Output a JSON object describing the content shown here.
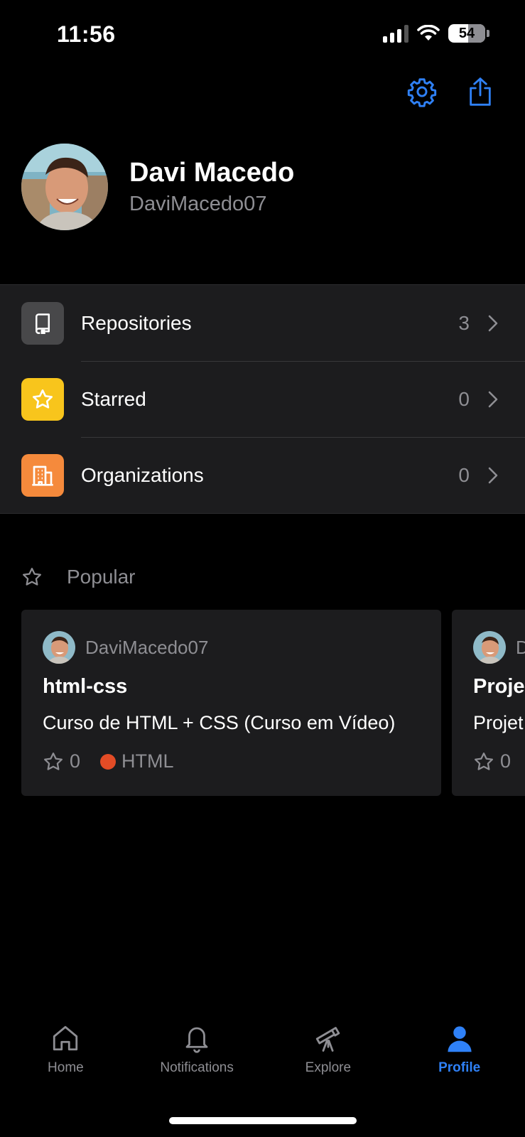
{
  "status_bar": {
    "time": "11:56",
    "battery": "54",
    "battery_level": 0.54
  },
  "profile": {
    "name": "Davi Macedo",
    "username": "DaviMacedo07"
  },
  "menu": [
    {
      "label": "Repositories",
      "count": "3",
      "color": "#48484a",
      "icon": "repo-icon"
    },
    {
      "label": "Starred",
      "count": "0",
      "color": "#f8c51c",
      "icon": "star-icon"
    },
    {
      "label": "Organizations",
      "count": "0",
      "color": "#f58a3c",
      "icon": "organization-icon"
    }
  ],
  "popular": {
    "label": "Popular",
    "cards": [
      {
        "owner": "DaviMacedo07",
        "title": "html-css",
        "description": "Curso de HTML + CSS (Curso em Vídeo)",
        "stars": "0",
        "language": "HTML",
        "language_color": "#e34c26"
      },
      {
        "owner": "D",
        "title": "Proje",
        "description": "Projet",
        "stars": "0"
      }
    ]
  },
  "tabs": [
    {
      "label": "Home",
      "icon": "home-icon"
    },
    {
      "label": "Notifications",
      "icon": "bell-icon"
    },
    {
      "label": "Explore",
      "icon": "telescope-icon"
    },
    {
      "label": "Profile",
      "icon": "person-icon",
      "active": true
    }
  ],
  "colors": {
    "accent": "#2f81f7",
    "background": "#000000",
    "surface": "#1c1c1e"
  }
}
